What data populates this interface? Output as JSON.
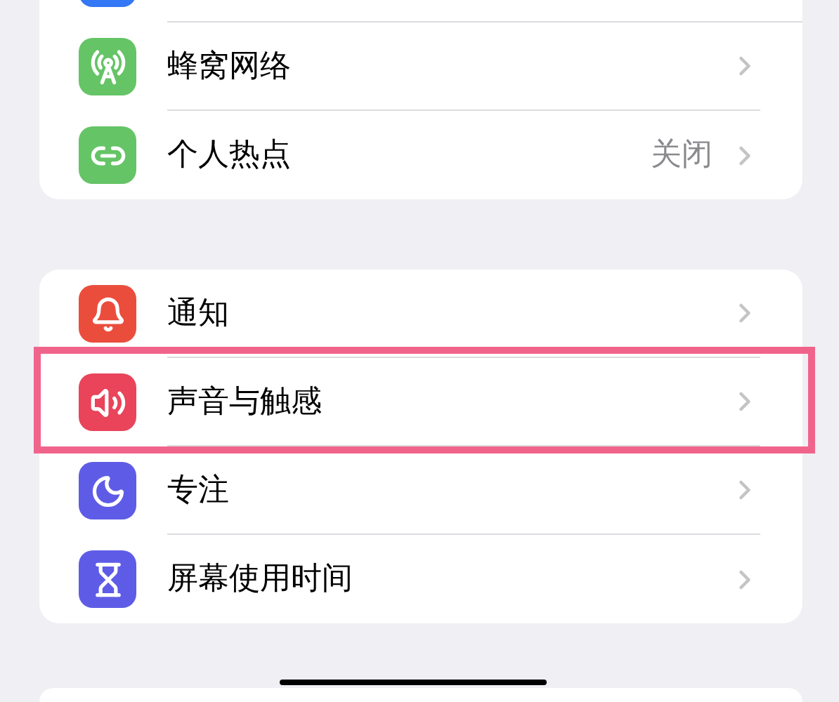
{
  "sections": [
    {
      "items": [
        {
          "label": "蜂窝网络",
          "highlighted": false
        },
        {
          "label": "个人热点",
          "value": "关闭",
          "highlighted": false
        }
      ]
    },
    {
      "items": [
        {
          "label": "通知",
          "highlighted": false
        },
        {
          "label": "声音与触感",
          "highlighted": true
        },
        {
          "label": "专注",
          "highlighted": false
        },
        {
          "label": "屏幕使用时间",
          "highlighted": false
        }
      ]
    }
  ]
}
